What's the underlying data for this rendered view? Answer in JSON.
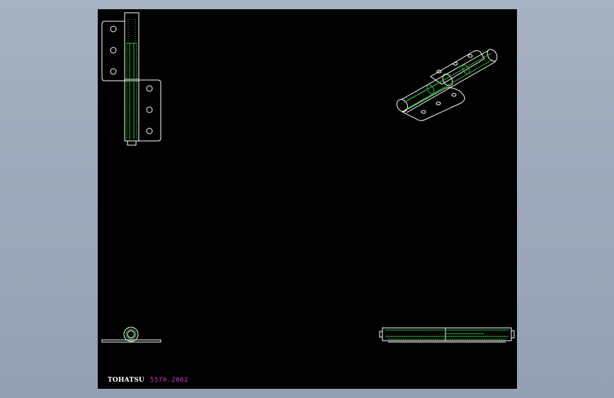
{
  "drawing": {
    "brand_text": "TOHATSU",
    "part_number": "5570.2062",
    "colors": {
      "background": "#000000",
      "outline": "#ffffff",
      "hidden": "#22c033",
      "part_number": "#d23cd2",
      "frame": "#9aa6b6"
    }
  }
}
